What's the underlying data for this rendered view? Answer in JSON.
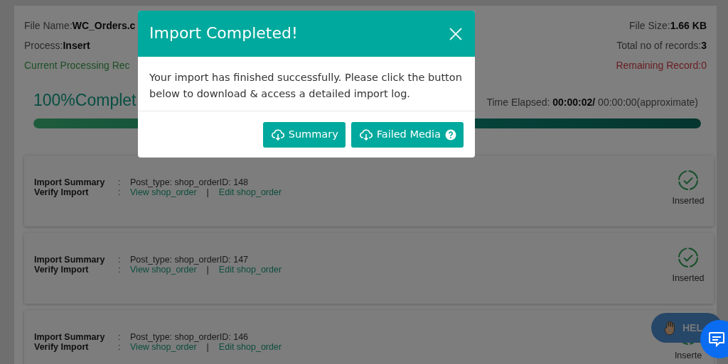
{
  "header": {
    "file_name_label": "File Name:",
    "file_name": "WC_Orders.c",
    "file_size_label": "File Size:",
    "file_size": "1.66 KB",
    "process_label": "Process:",
    "process": "Insert",
    "total_label": "Total no of records:",
    "total": "3",
    "current": "Current Processing Rec",
    "remaining": "Remaining Record:0"
  },
  "progress": {
    "percent_text": "100%Complet",
    "time_label": "Time Elapsed:",
    "time_elapsed": "00:00:02/",
    "time_estimate": "00:00:00(approximate)",
    "level": 1
  },
  "records": [
    {
      "summary_label": "Import Summary",
      "verify_label": "Verify Import",
      "colon_1": ":",
      "colon_2": ":",
      "summary": "Post_type: shop_orderID: 148",
      "view_link": "View shop_order",
      "divider": "|",
      "edit_link": "Edit shop_order",
      "status": "Inserted"
    },
    {
      "summary_label": "Import Summary",
      "verify_label": "Verify Import",
      "colon_1": ":",
      "colon_2": ":",
      "summary": "Post_type: shop_orderID: 147",
      "view_link": "View shop_order",
      "divider": "|",
      "edit_link": "Edit shop_order",
      "status": "Inserted"
    },
    {
      "summary_label": "Import Summary",
      "verify_label": "Verify Import",
      "colon_1": ":",
      "colon_2": ":",
      "summary": "Post_type: shop_orderID: 146",
      "view_link": "View shop_order",
      "divider": "|",
      "edit_link": "Edit shop_order",
      "status": "Inserte"
    }
  ],
  "help_button": {
    "label": "HEL"
  },
  "modal": {
    "title": "Import Completed!",
    "body": "Your import has finished successfully. Please click the button below to download & access a detailed import log.",
    "buttons": [
      {
        "label": "Summary",
        "kind": "download"
      },
      {
        "label": "Failed Media",
        "kind": "download-help"
      }
    ]
  }
}
